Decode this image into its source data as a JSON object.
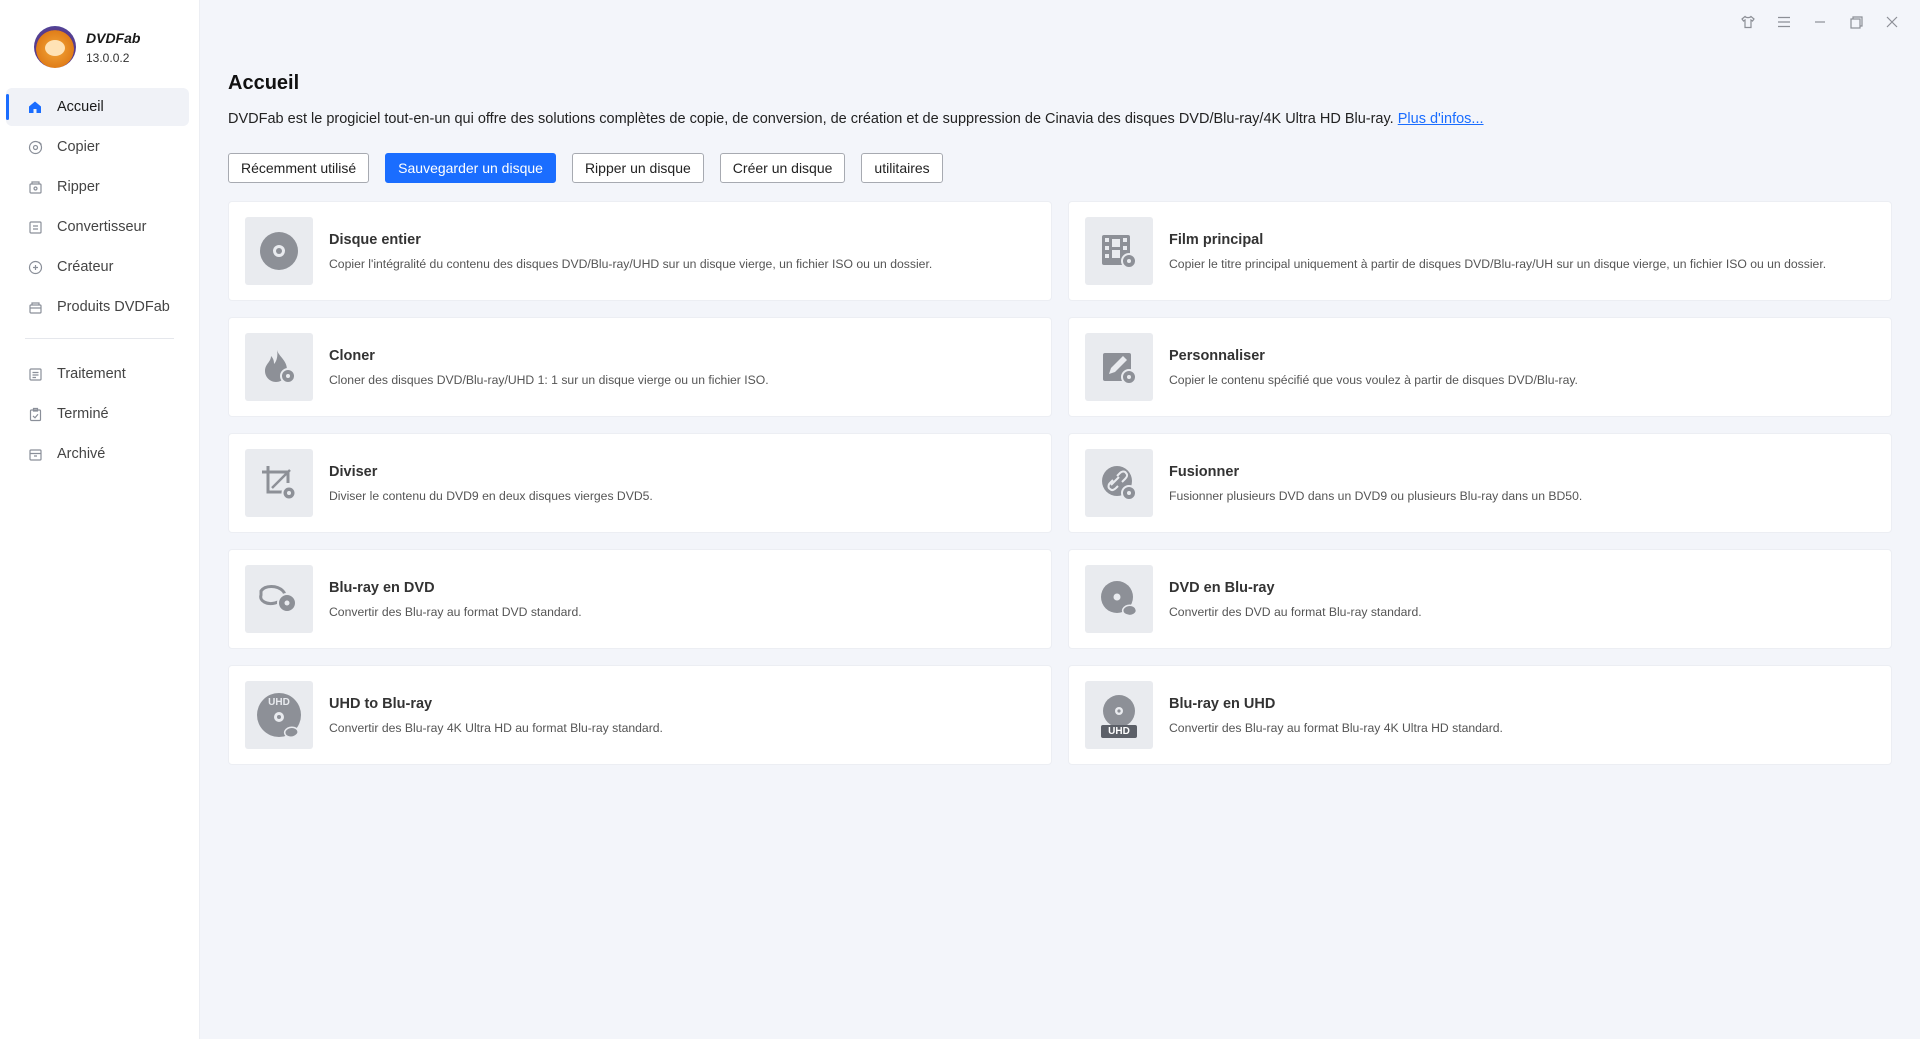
{
  "app": {
    "name": "DVDFab",
    "version": "13.0.0.2"
  },
  "sidebar": {
    "primary": [
      {
        "label": "Accueil",
        "icon": "home-icon",
        "active": true
      },
      {
        "label": "Copier",
        "icon": "copy-icon"
      },
      {
        "label": "Ripper",
        "icon": "ripper-icon"
      },
      {
        "label": "Convertisseur",
        "icon": "converter-icon"
      },
      {
        "label": "Créateur",
        "icon": "creator-icon"
      },
      {
        "label": "Produits DVDFab",
        "icon": "products-icon"
      }
    ],
    "secondary": [
      {
        "label": "Traitement",
        "icon": "processing-icon"
      },
      {
        "label": "Terminé",
        "icon": "done-icon"
      },
      {
        "label": "Archivé",
        "icon": "archive-icon"
      }
    ]
  },
  "window_controls": [
    "shirt-icon",
    "menu-icon",
    "minimize-icon",
    "restore-icon",
    "close-icon"
  ],
  "main": {
    "title": "Accueil",
    "intro": "DVDFab est le progiciel tout-en-un qui offre des solutions complètes de copie, de conversion, de création et de suppression de Cinavia des disques DVD/Blu-ray/4K Ultra HD Blu-ray.",
    "more_link": "Plus d'infos...",
    "tabs": [
      {
        "label": "Récemment utilisé"
      },
      {
        "label": "Sauvegarder un disque",
        "active": true
      },
      {
        "label": "Ripper un disque"
      },
      {
        "label": "Créer un disque"
      },
      {
        "label": "utilitaires"
      }
    ],
    "cards": [
      {
        "title": "Disque entier",
        "desc": "Copier l'intégralité du contenu des disques DVD/Blu-ray/UHD sur un disque vierge, un fichier ISO ou un dossier.",
        "icon": "disc-icon"
      },
      {
        "title": "Film principal",
        "desc": "Copier le titre principal uniquement à partir de disques DVD/Blu-ray/UH sur un disque vierge, un fichier ISO ou un dossier.",
        "icon": "film-icon"
      },
      {
        "title": "Cloner",
        "desc": "Cloner des disques DVD/Blu-ray/UHD 1: 1 sur un disque vierge ou un fichier ISO.",
        "icon": "flame-icon"
      },
      {
        "title": "Personnaliser",
        "desc": "Copier le contenu spécifié que vous voulez à partir de disques DVD/Blu-ray.",
        "icon": "edit-icon"
      },
      {
        "title": "Diviser",
        "desc": "Diviser le contenu du DVD9 en deux disques vierges DVD5.",
        "icon": "crop-icon"
      },
      {
        "title": "Fusionner",
        "desc": "Fusionner plusieurs DVD dans un DVD9 ou plusieurs Blu-ray dans un BD50.",
        "icon": "link-icon"
      },
      {
        "title": "Blu-ray en DVD",
        "desc": "Convertir des Blu-ray au format DVD standard.",
        "icon": "bluray-to-dvd-icon"
      },
      {
        "title": "DVD en Blu-ray",
        "desc": "Convertir des DVD au format Blu-ray standard.",
        "icon": "dvd-to-bluray-icon"
      },
      {
        "title": "UHD to Blu-ray",
        "desc": "Convertir des Blu-ray 4K Ultra HD au format Blu-ray standard.",
        "icon": "uhd-to-bluray-icon",
        "badge": "UHD"
      },
      {
        "title": "Blu-ray en UHD",
        "desc": "Convertir des Blu-ray au format Blu-ray 4K Ultra HD standard.",
        "icon": "bluray-to-uhd-icon",
        "badge": "UHD"
      }
    ]
  }
}
